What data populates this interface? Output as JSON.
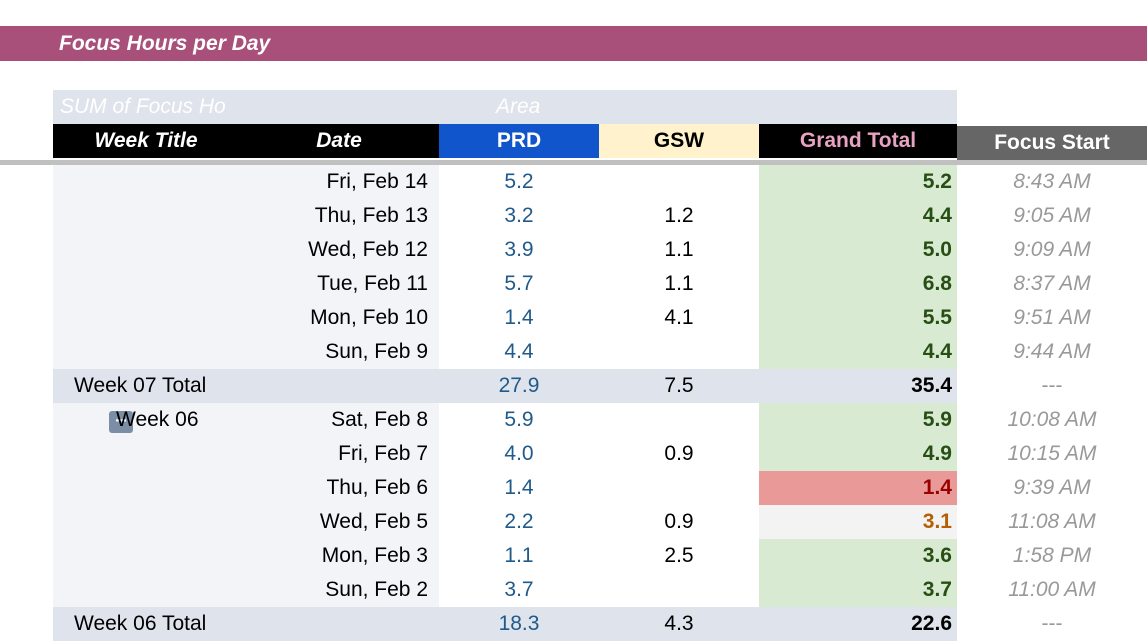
{
  "banner": {
    "title": "Focus Hours per Day"
  },
  "pivot": {
    "values_label": "SUM of Focus Ho",
    "columns_label": "Area"
  },
  "headers": {
    "week_title": "Week Title",
    "date": "Date",
    "prd": "PRD",
    "gsw": "GSW",
    "grand_total": "Grand Total",
    "focus_start": "Focus Start"
  },
  "rows": [
    {
      "week": "",
      "date": "Fri, Feb 14",
      "prd": "5.2",
      "gsw": "",
      "total": "5.2",
      "start": "8:43 AM",
      "tone": "green"
    },
    {
      "week": "",
      "date": "Thu, Feb 13",
      "prd": "3.2",
      "gsw": "1.2",
      "total": "4.4",
      "start": "9:05 AM",
      "tone": "green"
    },
    {
      "week": "",
      "date": "Wed, Feb 12",
      "prd": "3.9",
      "gsw": "1.1",
      "total": "5.0",
      "start": "9:09 AM",
      "tone": "green"
    },
    {
      "week": "",
      "date": "Tue, Feb 11",
      "prd": "5.7",
      "gsw": "1.1",
      "total": "6.8",
      "start": "8:37 AM",
      "tone": "green"
    },
    {
      "week": "",
      "date": "Mon, Feb 10",
      "prd": "1.4",
      "gsw": "4.1",
      "total": "5.5",
      "start": "9:51 AM",
      "tone": "green"
    },
    {
      "week": "",
      "date": "Sun, Feb 9",
      "prd": "4.4",
      "gsw": "",
      "total": "4.4",
      "start": "9:44 AM",
      "tone": "green"
    },
    {
      "type": "total",
      "week": "Week 07 Total",
      "date": "",
      "prd": "27.9",
      "gsw": "7.5",
      "total": "35.4",
      "start": "---"
    },
    {
      "week": "Week 06",
      "collapse": true,
      "date": "Sat, Feb 8",
      "prd": "5.9",
      "gsw": "",
      "total": "5.9",
      "start": "10:08 AM",
      "tone": "green"
    },
    {
      "week": "",
      "date": "Fri, Feb 7",
      "prd": "4.0",
      "gsw": "0.9",
      "total": "4.9",
      "start": "10:15 AM",
      "tone": "green"
    },
    {
      "week": "",
      "date": "Thu, Feb 6",
      "prd": "1.4",
      "gsw": "",
      "total": "1.4",
      "start": "9:39 AM",
      "tone": "red"
    },
    {
      "week": "",
      "date": "Wed, Feb 5",
      "prd": "2.2",
      "gsw": "0.9",
      "total": "3.1",
      "start": "11:08 AM",
      "tone": "gray"
    },
    {
      "week": "",
      "date": "Mon, Feb 3",
      "prd": "1.1",
      "gsw": "2.5",
      "total": "3.6",
      "start": "1:58 PM",
      "tone": "green"
    },
    {
      "week": "",
      "date": "Sun, Feb 2",
      "prd": "3.7",
      "gsw": "",
      "total": "3.7",
      "start": "11:00 AM",
      "tone": "green"
    },
    {
      "type": "total",
      "week": "Week 06 Total",
      "date": "",
      "prd": "18.3",
      "gsw": "4.3",
      "total": "22.6",
      "start": "---"
    }
  ],
  "collapse_symbol": "−"
}
